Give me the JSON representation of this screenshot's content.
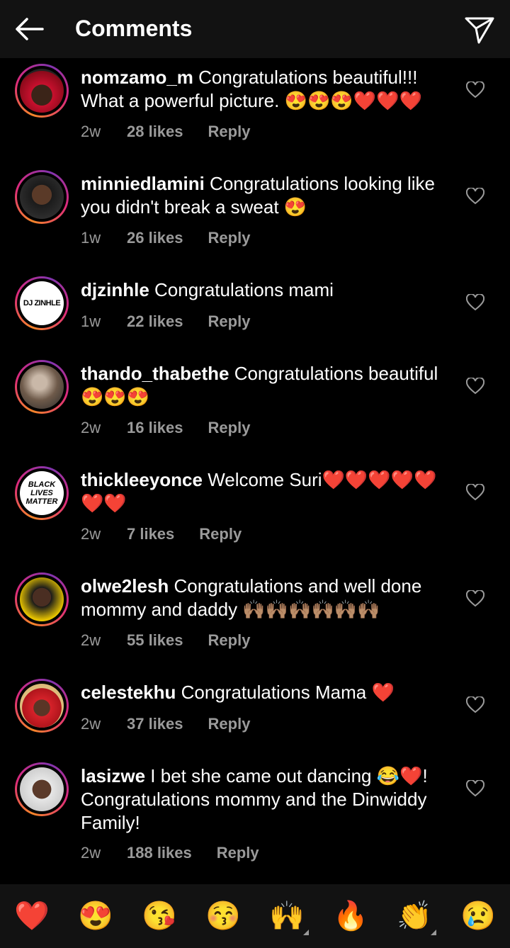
{
  "header": {
    "title": "Comments"
  },
  "comments": [
    {
      "username": "nomzamo_m",
      "text": "Congratulations beautiful!!! What a powerful picture. 😍😍😍❤️❤️❤️",
      "time": "2w",
      "likes": "28 likes",
      "reply": "Reply",
      "avatar": "portrait-red-headwrap"
    },
    {
      "username": "minniedlamini",
      "text": "Congratulations looking like you didn't break a sweat 😍",
      "time": "1w",
      "likes": "26 likes",
      "reply": "Reply",
      "avatar": "portrait"
    },
    {
      "username": "djzinhle",
      "text": "Congratulations mami",
      "time": "1w",
      "likes": "22 likes",
      "reply": "Reply",
      "avatar_text": "DJ ZINHLE"
    },
    {
      "username": "thando_thabethe",
      "text": "Congratulations beautiful 😍😍😍",
      "time": "2w",
      "likes": "16 likes",
      "reply": "Reply",
      "avatar": "portrait"
    },
    {
      "username": "thickleeyonce",
      "text": "Welcome Suri❤️❤️❤️❤️❤️❤️❤️",
      "time": "2w",
      "likes": "7 likes",
      "reply": "Reply",
      "avatar_text": "BLACK LIVES MATTER"
    },
    {
      "username": "olwe2lesh",
      "text": "Congratulations and well done mommy and daddy 🙌🏽🙌🏽🙌🏽🙌🏽🙌🏽🙌🏽",
      "time": "2w",
      "likes": "55 likes",
      "reply": "Reply",
      "avatar": "portrait-yellow"
    },
    {
      "username": "celestekhu",
      "text": "Congratulations Mama ❤️",
      "time": "2w",
      "likes": "37 likes",
      "reply": "Reply",
      "avatar": "portrait-red-hat"
    },
    {
      "username": "lasizwe",
      "text": "I bet she came out dancing 😂❤️! Congratulations mommy and the Dinwiddy Family!",
      "time": "2w",
      "likes": "188 likes",
      "reply": "Reply",
      "avatar": "portrait"
    }
  ],
  "emoji_bar": [
    "❤️",
    "😍",
    "😘",
    "😚",
    "🙌",
    "🔥",
    "👏",
    "😢"
  ],
  "colors": {
    "background": "#000000",
    "header": "#121212",
    "meta_text": "#9a9a9a",
    "heart": "#ed1c24"
  }
}
